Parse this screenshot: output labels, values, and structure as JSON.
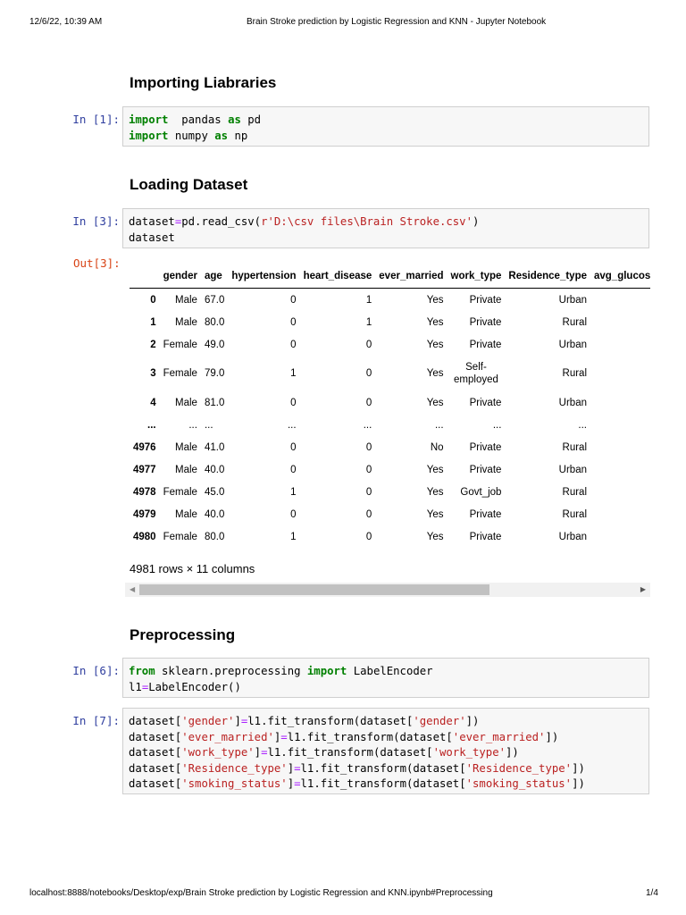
{
  "header": {
    "datetime": "12/6/22, 10:39 AM",
    "title": "Brain Stroke prediction by Logistic Regression and KNN - Jupyter Notebook"
  },
  "footer": {
    "url": "localhost:8888/notebooks/Desktop/exp/Brain Stroke prediction by Logistic Regression and KNN.ipynb#Preprocessing",
    "page": "1/4"
  },
  "headings": {
    "h1": "Importing Liabraries",
    "h2": "Loading Dataset",
    "h3": "Preprocessing"
  },
  "cells": [
    {
      "prompt": "In [1]:",
      "lines": [
        [
          [
            "kw",
            "import"
          ],
          [
            "",
            "  pandas "
          ],
          [
            "kw",
            "as"
          ],
          [
            "",
            " pd"
          ]
        ],
        [
          [
            "kw",
            "import"
          ],
          [
            "",
            " numpy "
          ],
          [
            "kw",
            "as"
          ],
          [
            "",
            " np"
          ]
        ]
      ]
    },
    {
      "prompt": "In [3]:",
      "lines": [
        [
          [
            "",
            "dataset"
          ],
          [
            "op",
            "="
          ],
          [
            "",
            "pd.read_csv("
          ],
          [
            "str",
            "r'D:\\csv files\\Brain Stroke.csv'"
          ],
          [
            "",
            ")"
          ]
        ],
        [
          [
            "",
            "dataset"
          ]
        ]
      ]
    },
    {
      "prompt": "In [6]:",
      "lines": [
        [
          [
            "kw",
            "from"
          ],
          [
            "",
            " sklearn.preprocessing "
          ],
          [
            "kw",
            "import"
          ],
          [
            "",
            " LabelEncoder"
          ]
        ],
        [
          [
            "",
            "l1"
          ],
          [
            "op",
            "="
          ],
          [
            "",
            "LabelEncoder()"
          ]
        ]
      ]
    },
    {
      "prompt": "In [7]:",
      "lines": [
        [
          [
            "",
            "dataset["
          ],
          [
            "str",
            "'gender'"
          ],
          [
            "",
            "]"
          ],
          [
            "op",
            "="
          ],
          [
            "",
            "l1.fit_transform(dataset["
          ],
          [
            "str",
            "'gender'"
          ],
          [
            "",
            "])"
          ]
        ],
        [
          [
            "",
            "dataset["
          ],
          [
            "str",
            "'ever_married'"
          ],
          [
            "",
            "]"
          ],
          [
            "op",
            "="
          ],
          [
            "",
            "l1.fit_transform(dataset["
          ],
          [
            "str",
            "'ever_married'"
          ],
          [
            "",
            "])"
          ]
        ],
        [
          [
            "",
            "dataset["
          ],
          [
            "str",
            "'work_type'"
          ],
          [
            "",
            "]"
          ],
          [
            "op",
            "="
          ],
          [
            "",
            "l1.fit_transform(dataset["
          ],
          [
            "str",
            "'work_type'"
          ],
          [
            "",
            "])"
          ]
        ],
        [
          [
            "",
            "dataset["
          ],
          [
            "str",
            "'Residence_type'"
          ],
          [
            "",
            "]"
          ],
          [
            "op",
            "="
          ],
          [
            "",
            "l1.fit_transform(dataset["
          ],
          [
            "str",
            "'Residence_type'"
          ],
          [
            "",
            "])"
          ]
        ],
        [
          [
            "",
            "dataset["
          ],
          [
            "str",
            "'smoking_status'"
          ],
          [
            "",
            "]"
          ],
          [
            "op",
            "="
          ],
          [
            "",
            "l1.fit_transform(dataset["
          ],
          [
            "str",
            "'smoking_status'"
          ],
          [
            "",
            "])"
          ]
        ]
      ]
    }
  ],
  "output": {
    "prompt": "Out[3]:",
    "columns": [
      "",
      "gender",
      "age",
      "hypertension",
      "heart_disease",
      "ever_married",
      "work_type",
      "Residence_type",
      "avg_glucose_level"
    ],
    "rows": [
      [
        "0",
        "Male",
        "67.0",
        "0",
        "1",
        "Yes",
        "Private",
        "Urban",
        ""
      ],
      [
        "1",
        "Male",
        "80.0",
        "0",
        "1",
        "Yes",
        "Private",
        "Rural",
        ""
      ],
      [
        "2",
        "Female",
        "49.0",
        "0",
        "0",
        "Yes",
        "Private",
        "Urban",
        ""
      ],
      [
        "3",
        "Female",
        "79.0",
        "1",
        "0",
        "Yes",
        "Self-\nemployed",
        "Rural",
        ""
      ],
      [
        "4",
        "Male",
        "81.0",
        "0",
        "0",
        "Yes",
        "Private",
        "Urban",
        ""
      ],
      [
        "...",
        "...",
        "...",
        "...",
        "...",
        "...",
        "...",
        "...",
        ""
      ],
      [
        "4976",
        "Male",
        "41.0",
        "0",
        "0",
        "No",
        "Private",
        "Rural",
        ""
      ],
      [
        "4977",
        "Male",
        "40.0",
        "0",
        "0",
        "Yes",
        "Private",
        "Urban",
        ""
      ],
      [
        "4978",
        "Female",
        "45.0",
        "1",
        "0",
        "Yes",
        "Govt_job",
        "Rural",
        ""
      ],
      [
        "4979",
        "Male",
        "40.0",
        "0",
        "0",
        "Yes",
        "Private",
        "Rural",
        ""
      ],
      [
        "4980",
        "Female",
        "80.0",
        "1",
        "0",
        "Yes",
        "Private",
        "Urban",
        ""
      ]
    ],
    "shape": "4981 rows × 11 columns"
  }
}
